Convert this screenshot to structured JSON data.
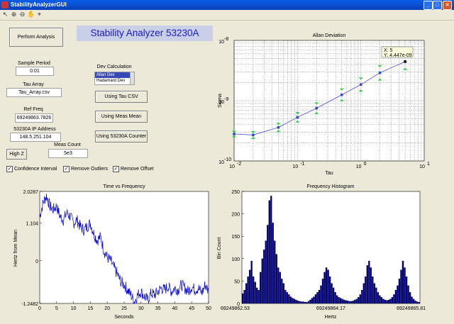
{
  "window": {
    "title": "StabilityAnalyzerGUI"
  },
  "toolbar": {
    "icons": [
      "arrow-icon",
      "zoom-in-icon",
      "zoom-out-icon",
      "pan-icon",
      "data-cursor-icon"
    ]
  },
  "controls": {
    "perform_button": "Perform Analysis",
    "app_title": "Stability Analyzer 53230A",
    "sample_period": {
      "label": "Sample Period",
      "value": "0.01"
    },
    "tau_array": {
      "label": "Tau Array",
      "value": "Tau_Array.csv"
    },
    "ref_freq": {
      "label": "Ref Freq",
      "value": "69249863.7826"
    },
    "ip": {
      "label": "53230A IP Address",
      "value": "148.5.251.104"
    },
    "meas_count": {
      "label": "Meas Count",
      "value": "5e3"
    },
    "high_z_button": "High Z",
    "dev_calc": {
      "label": "Dev Calculation",
      "options": [
        "Allan Dev",
        "Hadamard Dev"
      ],
      "selected": "Allan Dev"
    },
    "using_tau_button": "Using Tau CSV",
    "using_meas_button": "Using Meas Mean",
    "using_counter_button": "Using 53230A Counter",
    "checkboxes": [
      {
        "label": "Confidence Interval",
        "checked": true
      },
      {
        "label": "Remove Outliers",
        "checked": true
      },
      {
        "label": "Remove Offset",
        "checked": true
      }
    ]
  },
  "allan": {
    "title": "Allan Deviation",
    "xlabel": "Tau",
    "ylabel": "Sigma",
    "xticks": [
      "10",
      "10",
      "10",
      "10"
    ],
    "xexps": [
      "-2",
      "-1",
      "0",
      "1"
    ],
    "yticks": [
      "10",
      "10",
      "10"
    ],
    "yexps": [
      "-10",
      "-9",
      "-8"
    ],
    "datatip": {
      "x_label": "X: 5",
      "y_label": "Y: 4.447e-09"
    }
  },
  "timefreq": {
    "title": "Time vs Frequency",
    "xlabel": "Seconds",
    "ylabel": "Hertz from Mean",
    "xticks": [
      "0",
      "5",
      "10",
      "15",
      "20",
      "25",
      "30",
      "35",
      "40",
      "45",
      "50"
    ],
    "yticks": [
      "2.0287",
      "1.104",
      "0",
      "-1.2482"
    ]
  },
  "hist": {
    "title": "Frequency Histogram",
    "xlabel": "Hertz",
    "ylabel": "Bin Count",
    "xticks": [
      "69249862.53",
      "69249864.17",
      "69249865.81"
    ],
    "yticks": [
      "0",
      "50",
      "100",
      "150",
      "200",
      "250"
    ]
  },
  "chart_data": [
    {
      "type": "scatter",
      "title": "Allan Deviation",
      "xlabel": "Tau",
      "ylabel": "Sigma",
      "xscale": "log",
      "yscale": "log",
      "xlim": [
        0.01,
        10
      ],
      "ylim": [
        1e-10,
        1e-08
      ],
      "x": [
        0.01,
        0.02,
        0.05,
        0.1,
        0.2,
        0.5,
        1,
        2,
        5
      ],
      "y": [
        2.8e-10,
        2.7e-10,
        3.6e-10,
        5.3e-10,
        7.5e-10,
        1.25e-09,
        1.85e-09,
        2.9e-09,
        4.447e-09
      ],
      "grid": true
    },
    {
      "type": "line",
      "title": "Time vs Frequency",
      "xlabel": "Seconds",
      "ylabel": "Hertz from Mean",
      "xlim": [
        0,
        50
      ],
      "ylim": [
        -1.2482,
        2.0287
      ],
      "x": [
        0,
        1,
        2,
        3,
        4,
        5,
        6,
        7,
        8,
        9,
        10,
        11,
        12,
        13,
        14,
        15,
        16,
        17,
        18,
        19,
        20,
        21,
        22,
        23,
        24,
        25,
        26,
        27,
        28,
        29,
        30,
        31,
        32,
        33,
        34,
        35,
        36,
        37,
        38,
        39,
        40,
        41,
        42,
        43,
        44,
        45,
        46,
        47,
        48,
        49,
        50
      ],
      "y": [
        1.3,
        1.7,
        1.9,
        1.6,
        1.5,
        1.6,
        1.3,
        1.2,
        1.4,
        1.3,
        1.1,
        1.2,
        1.0,
        0.9,
        1.0,
        1.1,
        0.8,
        0.6,
        0.7,
        0.3,
        0.1,
        0.0,
        -0.2,
        -0.4,
        -0.6,
        -0.7,
        -0.85,
        -1.0,
        -1.2,
        -1.0,
        -0.9,
        -1.05,
        -1.15,
        -0.95,
        -1.0,
        -0.9,
        -0.8,
        -0.85,
        -0.75,
        -0.9,
        -0.8,
        -0.85,
        -0.7,
        -0.8,
        -0.9,
        -0.75,
        -0.85,
        -0.8,
        -0.95,
        -0.7,
        -0.9
      ]
    },
    {
      "type": "bar",
      "title": "Frequency Histogram",
      "xlabel": "Hertz",
      "ylabel": "Bin Count",
      "xlim": [
        69249862.53,
        69249865.81
      ],
      "ylim": [
        0,
        250
      ],
      "values": [
        22,
        30,
        45,
        60,
        75,
        95,
        60,
        48,
        35,
        30,
        70,
        100,
        120,
        140,
        175,
        230,
        240,
        180,
        140,
        110,
        80,
        70,
        55,
        45,
        30,
        25,
        20,
        15,
        12,
        10,
        8,
        6,
        5,
        4,
        4,
        3,
        3,
        5,
        8,
        12,
        15,
        20,
        25,
        30,
        40,
        55,
        70,
        80,
        75,
        60,
        45,
        35,
        25,
        18,
        14,
        12,
        10,
        8,
        7,
        6,
        5,
        5,
        6,
        8,
        10,
        14,
        20,
        30,
        45,
        60,
        85,
        95,
        80,
        60,
        45,
        35,
        25,
        18,
        14,
        10,
        8,
        7,
        8,
        10,
        14,
        20,
        30,
        40,
        55,
        75,
        95,
        80,
        60,
        40,
        25,
        15,
        10,
        6,
        4,
        3
      ]
    }
  ]
}
